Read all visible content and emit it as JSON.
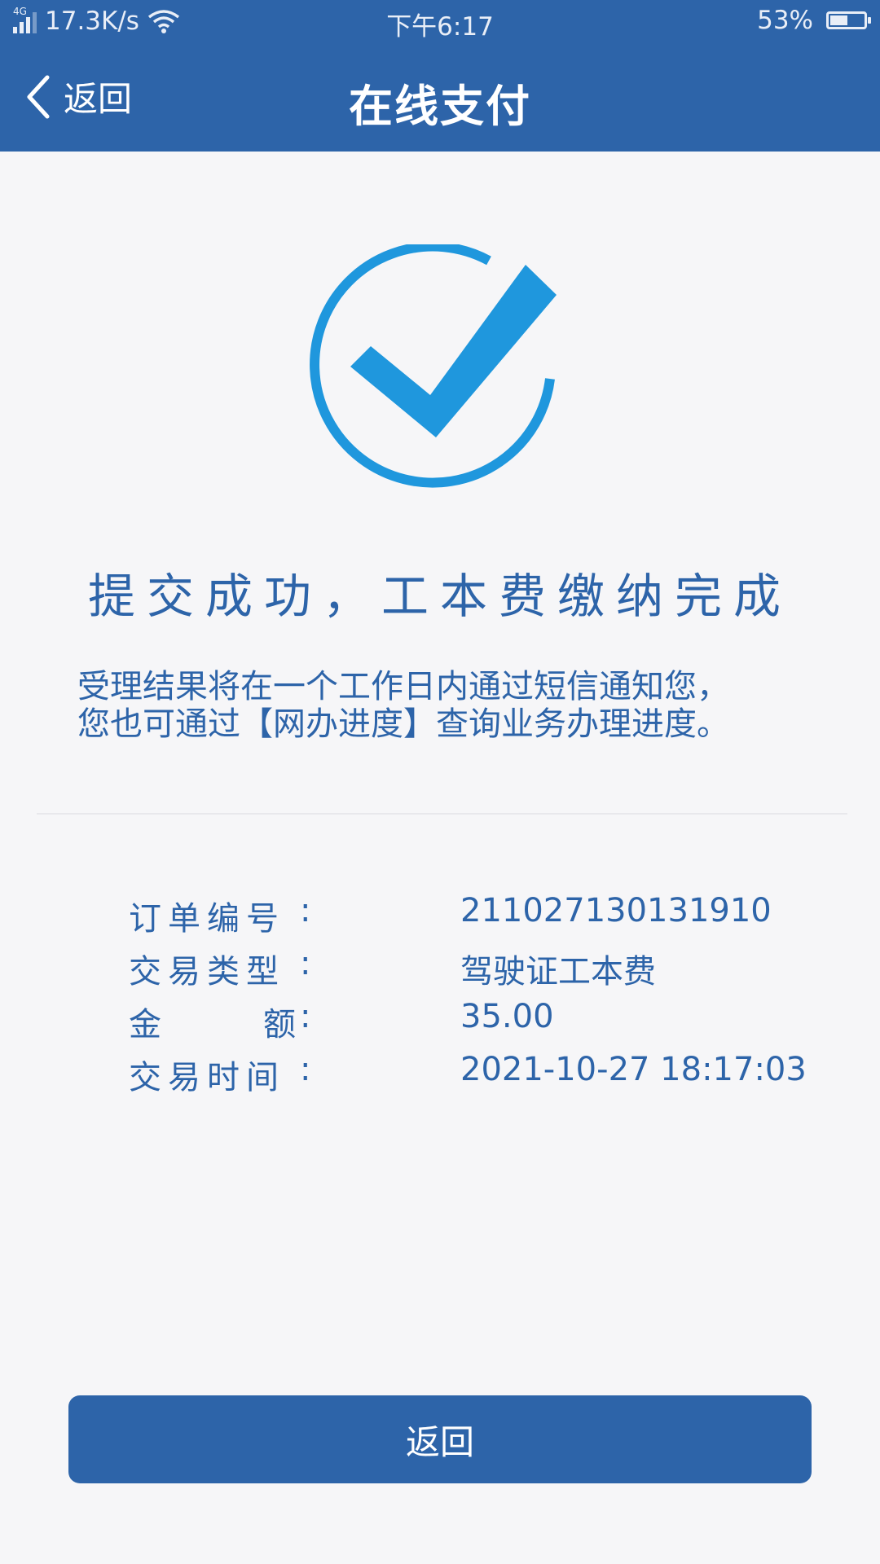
{
  "status_bar": {
    "network_type": "4G",
    "speed": "17.3K/s",
    "time": "下午6:17",
    "battery_percent": "53%",
    "battery_level": 0.53
  },
  "header": {
    "back_label": "返回",
    "title": "在线支付"
  },
  "success": {
    "title": "提交成功，工本费缴纳完成",
    "desc_line1": "受理结果将在一个工作日内通过短信通知您，",
    "desc_line2": "您也可通过【网办进度】查询业务办理进度。"
  },
  "details": {
    "order_no_label": "订单编号",
    "order_no_value": "211027130131910",
    "type_label": "交易类型",
    "type_value": "驾驶证工本费",
    "amount_label_char1": "金",
    "amount_label_char2": "额",
    "amount_value": "35.00",
    "time_label": "交易时间",
    "time_value": "2021-10-27 18:17:03",
    "colon": ":"
  },
  "bottom_button": {
    "label": "返回"
  },
  "colors": {
    "primary": "#2d64a9",
    "check": "#1f97dd",
    "background": "#f6f6f8"
  }
}
